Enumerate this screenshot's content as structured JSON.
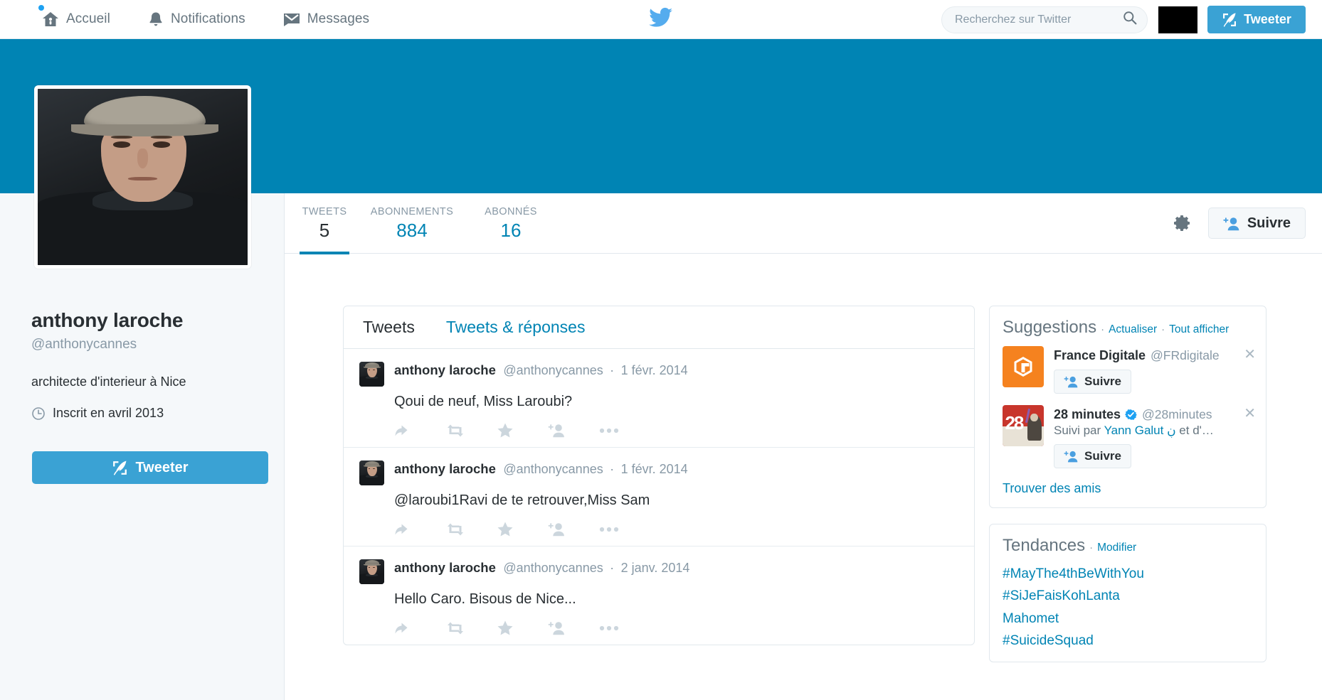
{
  "topnav": {
    "items": [
      {
        "label": "Accueil",
        "icon": "home-icon",
        "badge": true
      },
      {
        "label": "Notifications",
        "icon": "bell-icon",
        "badge": false
      },
      {
        "label": "Messages",
        "icon": "envelope-icon",
        "badge": false
      }
    ],
    "logo": "twitter-bird-logo",
    "search": {
      "placeholder": "Recherchez sur Twitter",
      "value": "",
      "icon": "search-icon"
    },
    "compose_label": "Tweeter"
  },
  "profile": {
    "display_name": "anthony laroche",
    "handle": "@anthonycannes",
    "bio": "architecte d'interieur à Nice",
    "joined": "Inscrit en avril 2013",
    "joined_icon": "clock-icon",
    "compose_label": "Tweeter",
    "avatar_alt": "profile-photo"
  },
  "stats": [
    {
      "label": "TWEETS",
      "value": "5",
      "active": true,
      "blue": false
    },
    {
      "label": "ABONNEMENTS",
      "value": "884",
      "active": false,
      "blue": true
    },
    {
      "label": "ABONNÉS",
      "value": "16",
      "active": false,
      "blue": true
    }
  ],
  "profile_actions": {
    "gear_icon": "gear-icon",
    "follow_label": "Suivre",
    "follow_icon": "add-user-icon"
  },
  "timeline": {
    "tabs": [
      {
        "label": "Tweets",
        "active": true
      },
      {
        "label": "Tweets & réponses",
        "active": false
      }
    ],
    "tweets": [
      {
        "name": "anthony laroche",
        "handle": "@anthonycannes",
        "separator": "·",
        "date": "1 févr. 2014",
        "text": "Qoui de neuf, Miss Laroubi?"
      },
      {
        "name": "anthony laroche",
        "handle": "@anthonycannes",
        "separator": "·",
        "date": "1 févr. 2014",
        "text": "@laroubi1Ravi de te retrouver,Miss Sam"
      },
      {
        "name": "anthony laroche",
        "handle": "@anthonycannes",
        "separator": "·",
        "date": "2 janv. 2014",
        "text": "Hello Caro. Bisous de Nice..."
      }
    ],
    "actions": [
      "reply-icon",
      "retweet-icon",
      "favorite-icon",
      "add-user-icon",
      "more-icon"
    ]
  },
  "suggestions": {
    "title": "Suggestions",
    "dot": "·",
    "refresh_label": "Actualiser",
    "viewall_label": "Tout afficher",
    "items": [
      {
        "name": "France Digitale",
        "handle": "@FRdigitale",
        "verified": false,
        "subtitle": "",
        "subtitle_link": "",
        "follow_label": "Suivre",
        "avatar": "france-digitale-logo",
        "close_icon": "close-icon"
      },
      {
        "name": "28 minutes",
        "handle": "@28minutes",
        "verified": true,
        "subtitle_prefix": "Suivi par ",
        "subtitle_link": "Yann Galut ڹ",
        "subtitle_suffix": " et d'…",
        "follow_label": "Suivre",
        "avatar": "28-minutes-logo",
        "close_icon": "close-icon"
      }
    ],
    "find_friends_label": "Trouver des amis"
  },
  "trends": {
    "title": "Tendances",
    "dot": "·",
    "edit_label": "Modifier",
    "items": [
      "#MayThe4thBeWithYou",
      "#SiJeFaisKohLanta",
      "Mahomet",
      "#SuicideSquad"
    ]
  },
  "colors": {
    "brand_blue": "#1da1f2",
    "banner_blue": "#0084b4",
    "button_blue": "#3aa2d4",
    "link_blue": "#0084b4",
    "muted_gray": "#8899a6",
    "text_dark": "#292f33",
    "panel_bg": "#f5f8fa",
    "border": "#e1e8ed"
  }
}
